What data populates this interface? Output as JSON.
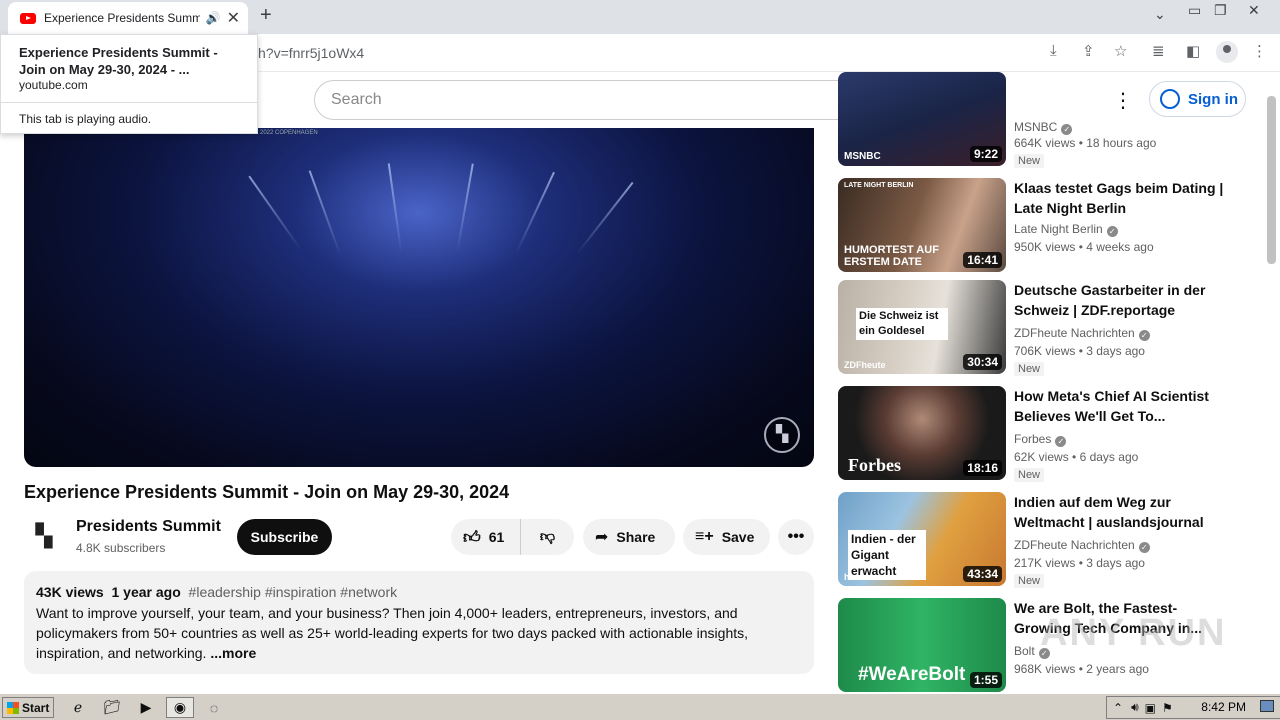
{
  "browser": {
    "tab": {
      "title": "Experience Presidents Summit -",
      "audio_icon": "speaker-icon",
      "close_icon": "close-icon"
    },
    "new_tab_icon": "plus-icon",
    "url": "h?v=fnrr5j1oWx4",
    "toolbar_icons": [
      "download-icon",
      "share-icon",
      "bookmark-star-icon",
      "media-control-icon",
      "side-panel-icon",
      "profile-icon",
      "menu-icon"
    ],
    "window_icons": [
      "chevron-down-icon",
      "minimize-icon",
      "restore-icon",
      "close-icon"
    ]
  },
  "tooltip": {
    "title": "Experience Presidents Summit - Join on May 29-30, 2024 - ...",
    "domain": "youtube.com",
    "audio_text": "This tab is playing audio."
  },
  "youtube_header": {
    "search_placeholder": "Search",
    "sign_in": "Sign in"
  },
  "video": {
    "title": "Experience Presidents Summit - Join on May 29-30, 2024",
    "channel": "Presidents Summit",
    "subscribers": "4.8K subscribers",
    "subscribe_label": "Subscribe",
    "likes": "61",
    "share_label": "Share",
    "save_label": "Save",
    "views": "43K views",
    "age": "1 year ago",
    "tags": "#leadership #inspiration #network",
    "description": "Want to improve yourself, your team, and your business? Then join 4,000+ leaders, entrepreneurs, investors, and policymakers from 50+ countries as well as 25+ world-leading experts for two days packed with actionable insights, inspiration, and networking.",
    "more_label": "...more",
    "player_badge": "2022 COPENHAGEN"
  },
  "recommendations": [
    {
      "title": "",
      "channel": "MSNBC",
      "views": "664K views",
      "age": "18 hours ago",
      "duration": "9:22",
      "badge": "New",
      "thumb_text": "MSNBC"
    },
    {
      "title": "Klaas testet Gags beim Dating | Late Night Berlin",
      "channel": "Late Night Berlin",
      "views": "950K views",
      "age": "4 weeks ago",
      "duration": "16:41",
      "thumb_text": "HUMORTEST AUF ERSTEM DATE",
      "thumb_label": "LATE NIGHT BERLIN"
    },
    {
      "title": "Deutsche Gastarbeiter in der Schweiz | ZDF.reportage",
      "channel": "ZDFheute Nachrichten",
      "views": "706K views",
      "age": "3 days ago",
      "duration": "30:34",
      "badge": "New",
      "thumb_text": "Die Schweiz ist ein Goldesel",
      "thumb_label": "ZDFheute"
    },
    {
      "title": "How Meta's Chief AI Scientist Believes We'll Get To...",
      "channel": "Forbes",
      "views": "62K views",
      "age": "6 days ago",
      "duration": "18:16",
      "badge": "New",
      "thumb_text": "Forbes"
    },
    {
      "title": "Indien auf dem Weg zur Weltmacht | auslandsjournal",
      "channel": "ZDFheute Nachrichten",
      "views": "217K views",
      "age": "3 days ago",
      "duration": "43:34",
      "badge": "New",
      "thumb_text": "Indien - der Gigant erwacht",
      "thumb_label": "heute"
    },
    {
      "title": "We are Bolt, the Fastest-Growing Tech Company in...",
      "channel": "Bolt",
      "views": "968K views",
      "age": "2 years ago",
      "duration": "1:55",
      "thumb_text": "#WeAreBolt"
    }
  ],
  "watermark": "ANY RUN",
  "taskbar": {
    "start_label": "Start",
    "apps": [
      "ie-icon",
      "folder-icon",
      "media-player-icon",
      "chrome-icon",
      "edge-icon"
    ],
    "clock": "8:42 PM"
  }
}
